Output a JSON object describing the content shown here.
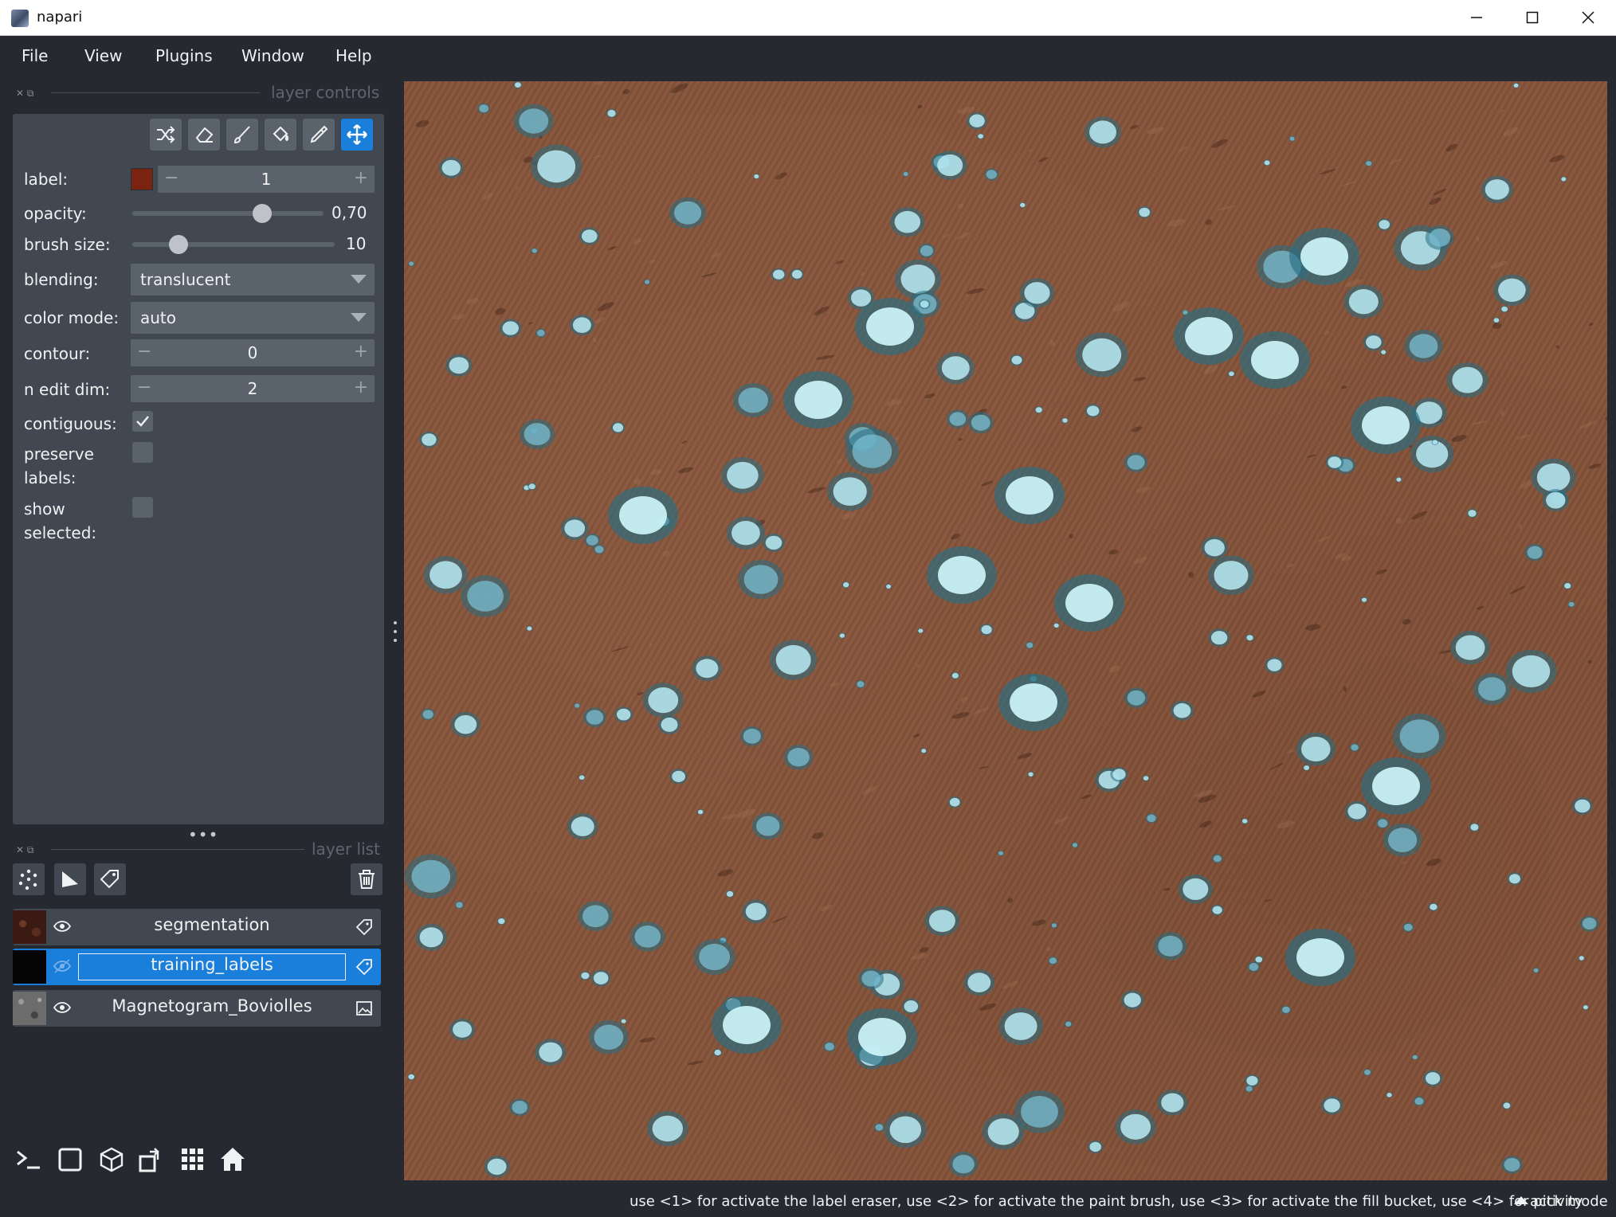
{
  "window": {
    "title": "napari"
  },
  "menu": [
    "File",
    "View",
    "Plugins",
    "Window",
    "Help"
  ],
  "layer_controls": {
    "title": "layer controls",
    "tools": [
      "shuffle-icon",
      "eraser-icon",
      "paint-brush-icon",
      "fill-bucket-icon",
      "color-picker-icon",
      "pan-zoom-icon"
    ],
    "active_tool": "pan-zoom-icon",
    "label": {
      "caption": "label:",
      "value": "1",
      "color": "#7a2310"
    },
    "opacity": {
      "caption": "opacity:",
      "value": "0,70",
      "fraction": 0.7
    },
    "brush_size": {
      "caption": "brush size:",
      "value": "10",
      "fraction": 0.2
    },
    "blending": {
      "caption": "blending:",
      "value": "translucent"
    },
    "color_mode": {
      "caption": "color mode:",
      "value": "auto"
    },
    "contour": {
      "caption": "contour:",
      "value": "0"
    },
    "n_edit_dim": {
      "caption": "n edit dim:",
      "value": "2"
    },
    "contiguous": {
      "caption": "contiguous:",
      "checked": true
    },
    "preserve_labels": {
      "caption_line1": "preserve",
      "caption_line2": "labels:",
      "checked": false
    },
    "show_selected": {
      "caption_line1": "show",
      "caption_line2": "selected:",
      "checked": false
    }
  },
  "layer_list": {
    "title": "layer list",
    "layers": [
      {
        "name": "segmentation",
        "type_icon": "labels-icon",
        "visible": true,
        "selected": false
      },
      {
        "name": "training_labels",
        "type_icon": "labels-icon",
        "visible": true,
        "selected": true
      },
      {
        "name": "Magnetogram_Boviolles",
        "type_icon": "image-icon",
        "visible": true,
        "selected": false
      }
    ]
  },
  "status": {
    "message": "use <1> for activate the label eraser, use <2> for activate the paint brush, use <3> for activate the fill bucket, use <4> for pick mode",
    "activity": "activity"
  },
  "colors": {
    "background": "#262930",
    "panel": "#414851",
    "control": "#5a626c",
    "accent": "#1a7fdb",
    "image_brown": "#86553c",
    "segment_cyan": "#bff0f7"
  }
}
